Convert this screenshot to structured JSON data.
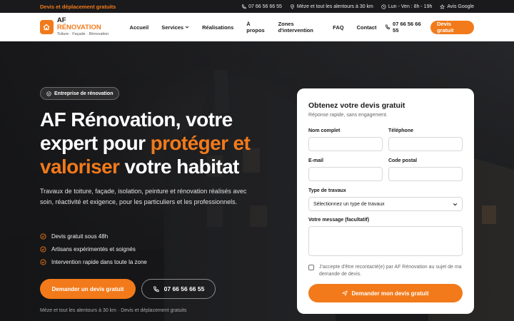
{
  "topbar": {
    "promo": "Devis et déplacement gratuits",
    "phone": "07 66 56 66 55",
    "area": "Mèze et tout les alentours à 30 km",
    "hours": "Lun - Ven : 8h - 19h",
    "reviews": "Avis Google"
  },
  "header": {
    "logo_main": "AF",
    "logo_accent": "RÉNOVATION",
    "logo_tagline": "Toiture · Façade · Rénovation",
    "nav": [
      {
        "label": "Accueil"
      },
      {
        "label": "Services"
      },
      {
        "label": "Réalisations"
      },
      {
        "label": "À propos"
      },
      {
        "label": "Zones d'intervention"
      },
      {
        "label": "FAQ"
      },
      {
        "label": "Contact"
      }
    ],
    "phone": "07 66 56 66 55",
    "cta": "Devis gratuit"
  },
  "hero": {
    "badge": "Entreprise de rénovation",
    "headline_1": "AF Rénovation, votre",
    "headline_2a": "expert pour ",
    "headline_2b": "protéger et",
    "headline_3a": "valoriser",
    "headline_3b": " votre habitat",
    "description": "Travaux de toiture, façade, isolation, peinture et rénovation réalisés avec soin, réactivité et exigence, pour les particuliers et les professionnels.",
    "bullets": [
      "Devis gratuit sous 48h",
      "Artisans expérimentés et soignés",
      "Intervention rapide dans toute la zone"
    ],
    "cta_primary": "Demander un devis gratuit",
    "cta_phone": "07 66 56 66 55",
    "footnote": "Mèze et tout les alentours à 30 km · Devis et déplacement gratuits"
  },
  "form": {
    "title": "Obtenez votre devis gratuit",
    "subtitle": "Réponse rapide, sans engagement.",
    "labels": {
      "name": "Nom complet",
      "phone": "Téléphone",
      "email": "E-mail",
      "postal": "Code postal",
      "type": "Type de travaux",
      "message": "Votre message (facultatif)"
    },
    "type_selected": "Sélectionnez un type de travaux",
    "consent": "J'accepte d'être recontacté(e) par AF Rénovation au sujet de ma demande de devis.",
    "submit": "Demander mon devis gratuit"
  },
  "colors": {
    "accent": "#f27a1a",
    "dark": "#1a1a1c"
  }
}
